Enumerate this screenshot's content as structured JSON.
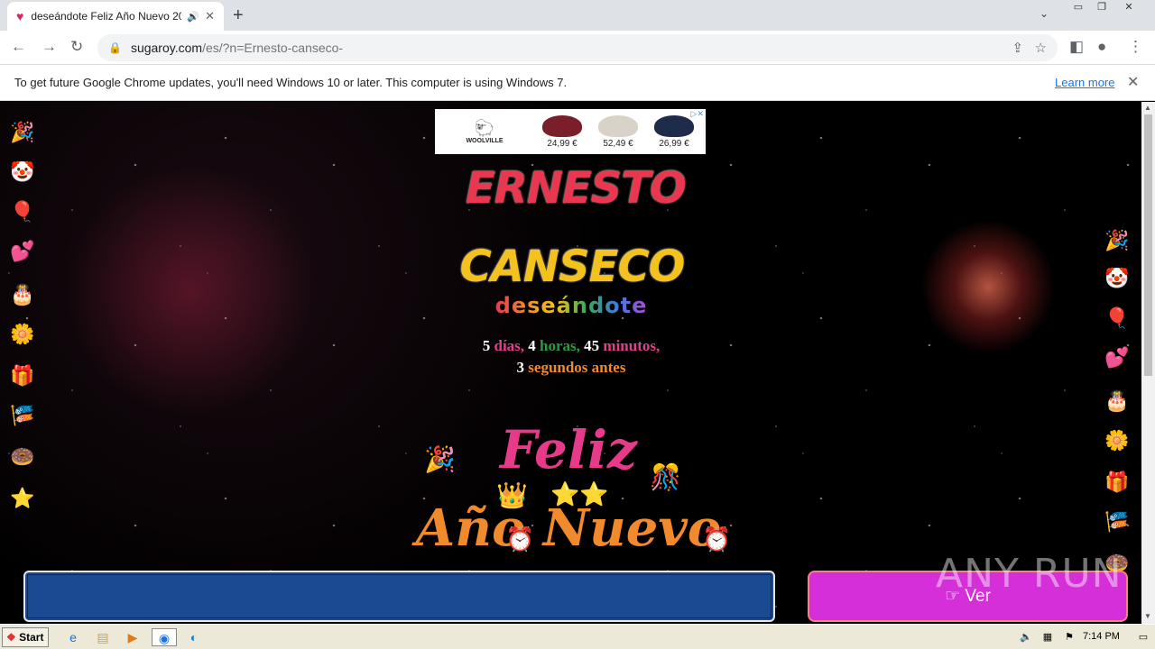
{
  "browser": {
    "tab_title": "deseándote Feliz Año Nuevo 20",
    "url_host": "sugaroy.com",
    "url_path": "/es/?n=Ernesto-canseco-",
    "infobar_message": "To get future Google Chrome updates, you'll need Windows 10 or later. This computer is using Windows 7.",
    "infobar_link": "Learn more"
  },
  "ad": {
    "brand": "WOOLVILLE",
    "prices": [
      "24,99 €",
      "52,49 €",
      "26,99 €"
    ]
  },
  "greeting": {
    "first_name": "ERNESTO",
    "last_name": "CANSECO",
    "wishing": "deseándote",
    "countdown": {
      "days_num": "5",
      "days_label": "días,",
      "hours_num": "4",
      "hours_label": "horas,",
      "mins_num": "45",
      "mins_label": "minutos,",
      "secs_num": "3",
      "secs_label": "segundos antes"
    },
    "line1": "Feliz",
    "line2": "Año Nuevo"
  },
  "form": {
    "input_value": "",
    "button_label": "Ver"
  },
  "watermark": "ANY RUN",
  "taskbar": {
    "start_label": "Start",
    "time": "7:14 PM"
  }
}
